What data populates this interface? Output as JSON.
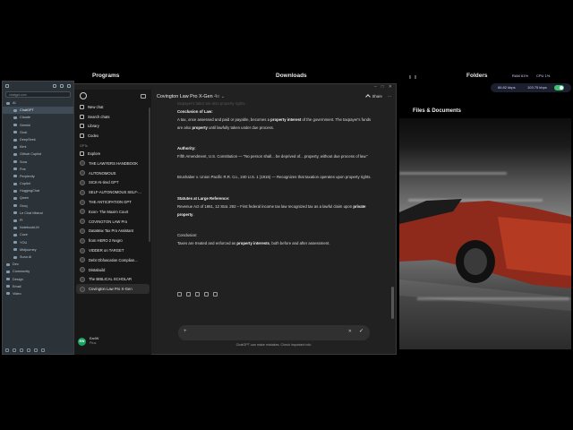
{
  "desktop": {
    "programs_label": "Programs",
    "downloads_label": "Downloads",
    "folders_label": "Folders",
    "ram_label": "RAM 61%",
    "cpu_label": "CPU 1%",
    "net_down": "86.82 kbps",
    "net_up": "103.75 kbps",
    "files_title": "Files & Documents",
    "toggle_color": "#3cc474"
  },
  "tree": {
    "search_placeholder": "chatgpt.com",
    "items": [
      {
        "label": "AI",
        "level": "root"
      },
      {
        "label": "ChatGPT",
        "level": "child",
        "selected": true
      },
      {
        "label": "Claude",
        "level": "child"
      },
      {
        "label": "Gemini",
        "level": "child"
      },
      {
        "label": "Grok",
        "level": "child"
      },
      {
        "label": "DeepSeek",
        "level": "child"
      },
      {
        "label": "Kimi",
        "level": "child"
      },
      {
        "label": "Github Copilot",
        "level": "child"
      },
      {
        "label": "Sora",
        "level": "child"
      },
      {
        "label": "Poe",
        "level": "child"
      },
      {
        "label": "Perplexity",
        "level": "child"
      },
      {
        "label": "Copilot",
        "level": "child"
      },
      {
        "label": "HuggingChat",
        "level": "child"
      },
      {
        "label": "Qwen",
        "level": "child"
      },
      {
        "label": "Groq",
        "level": "child"
      },
      {
        "label": "Le Chat Mistral",
        "level": "child"
      },
      {
        "label": "Pi",
        "level": "child"
      },
      {
        "label": "NotebookLM",
        "level": "child"
      },
      {
        "label": "Coze",
        "level": "child"
      },
      {
        "label": "YOU",
        "level": "child"
      },
      {
        "label": "Midjourney",
        "level": "child"
      },
      {
        "label": "Suno AI",
        "level": "child"
      },
      {
        "label": "Dev",
        "level": "root"
      },
      {
        "label": "Community",
        "level": "root"
      },
      {
        "label": "Design",
        "level": "root"
      },
      {
        "label": "Email",
        "level": "root"
      },
      {
        "label": "Video",
        "level": "root"
      }
    ]
  },
  "chat_sidebar": {
    "new_chat": "New chat",
    "search_chats": "Search chats",
    "library": "Library",
    "codex": "Codex",
    "gpts_section": "GPTs",
    "explore": "Explore",
    "gpts": [
      "THE LAWYERS HANDBOOK",
      "AUTONOMOUS",
      "SICK-N-tired GPT",
      "SELF-AUTONOMOUS SELF-...",
      "THE ANTICIPATION GPT",
      "Exon- The Maxim Court",
      "COVINGTON LAW Pro",
      "DataMax Tax Pro Assistant",
      "from HERO 2 Negro",
      "VIDDER on TARGET",
      "Debt Obfuscation Complian...",
      "Distabuild",
      "The BIBLICAL SCHOLAR",
      "Covington Law Pro X-Gen"
    ],
    "active_gpt_index": 13,
    "user_initials": "EW",
    "user_name": "EarlW",
    "user_plan": "Plus"
  },
  "chat": {
    "model_name": "Covington Law Pro X-Gen",
    "model_version": "4o",
    "share_label": "Share",
    "faded_line": "taxpayer's labor are also property rights.",
    "conclusion_of_law_heading": "Conclusion of Law:",
    "conclusion_of_law_1": "A tax, once assessed and paid or payable, becomes a ",
    "conclusion_of_law_bold": "property interest",
    "conclusion_of_law_2": " of the government. The taxpayer's funds are also ",
    "conclusion_of_law_bold2": "property",
    "conclusion_of_law_3": " until lawfully taken under due process.",
    "authority_heading": "Authority:",
    "authority_text": "Fifth Amendment, U.S. Constitution — \"No person shall... be deprived of... property, without due process of law.\"",
    "case_text": "Brushaber v. Union Pacific R.R. Co., 240 U.S. 1 (1916) — Recognizes that taxation operates upon property rights.",
    "statutes_heading": "Statutes at Large Reference:",
    "statutes_1": "Revenue Act of 1861, 12 Stat. 292 – First federal income tax law recognized tax as a lawful claim upon ",
    "statutes_bold": "private property",
    "statutes_2": ".",
    "conclusion_heading": "Conclusion:",
    "conclusion_1": "Taxes are treated and enforced as ",
    "conclusion_bold": "property interests",
    "conclusion_2": ", both before and after assessment.",
    "composer_placeholder": "",
    "disclaimer": "ChatGPT can make mistakes. Check important info."
  }
}
